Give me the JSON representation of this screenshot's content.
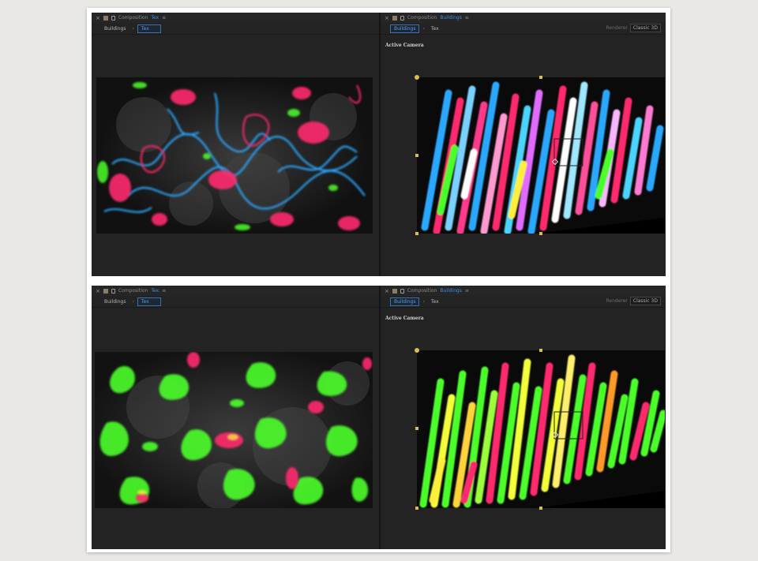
{
  "panels": {
    "top_left": {
      "header": {
        "prefix": "Composition",
        "comp_name": "Tex"
      },
      "tabs": [
        {
          "label": "Buildings",
          "active": false
        },
        {
          "label": "Tex",
          "active": true
        }
      ],
      "tab_separator": "‹"
    },
    "top_right": {
      "header": {
        "prefix": "Composition",
        "comp_name": "Buildings"
      },
      "tabs": [
        {
          "label": "Buildings",
          "active": true
        },
        {
          "label": "Tex",
          "active": false
        }
      ],
      "tab_separator": "‹",
      "renderer_label": "Renderer",
      "renderer_value": "Classic 3D",
      "camera_label": "Active Camera"
    },
    "bottom_left": {
      "header": {
        "prefix": "Composition",
        "comp_name": "Tex"
      },
      "tabs": [
        {
          "label": "Buildings",
          "active": false
        },
        {
          "label": "Tex",
          "active": true
        }
      ],
      "tab_separator": "‹"
    },
    "bottom_right": {
      "header": {
        "prefix": "Composition",
        "comp_name": "Buildings"
      },
      "tabs": [
        {
          "label": "Buildings",
          "active": true
        },
        {
          "label": "Tex",
          "active": false
        }
      ],
      "tab_separator": "‹",
      "renderer_label": "Renderer",
      "renderer_value": "Classic 3D",
      "camera_label": "Active Camera"
    }
  },
  "icons": {
    "close": "close-icon",
    "composition": "composition-icon",
    "lock": "lock-icon",
    "menu": "panel-menu-icon"
  },
  "colors": {
    "accent": "#3d8fe6",
    "handle": "#d9bf48",
    "panel_bg": "#232323",
    "neon_pink": "#ff2a6d",
    "neon_blue": "#2aa8ff",
    "neon_green": "#4cff2a",
    "neon_yellow": "#f4ff3a"
  }
}
